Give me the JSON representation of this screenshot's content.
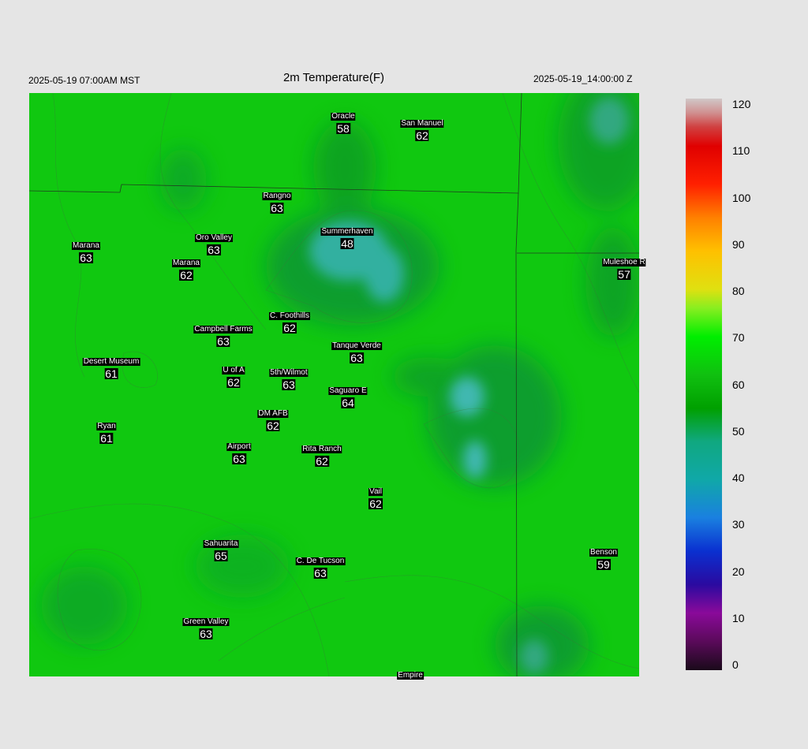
{
  "header": {
    "left": "2025-05-19 07:00AM MST",
    "title": "2m Temperature(F)",
    "right": "2025-05-19_14:00:00 Z"
  },
  "colorbar": {
    "min": 0,
    "max": 120,
    "ticks": [
      "120",
      "110",
      "100",
      "90",
      "80",
      "70",
      "60",
      "50",
      "40",
      "30",
      "20",
      "10",
      "0"
    ],
    "stops": [
      {
        "v": 0,
        "c": "#1a0a1a"
      },
      {
        "v": 6,
        "c": "#5a0a5a"
      },
      {
        "v": 12,
        "c": "#8a0a9a"
      },
      {
        "v": 18,
        "c": "#2a0aa0"
      },
      {
        "v": 25,
        "c": "#0a30d0"
      },
      {
        "v": 32,
        "c": "#1a80e0"
      },
      {
        "v": 40,
        "c": "#10a8a8"
      },
      {
        "v": 48,
        "c": "#10a880"
      },
      {
        "v": 55,
        "c": "#00a000"
      },
      {
        "v": 62,
        "c": "#10c010"
      },
      {
        "v": 70,
        "c": "#00ee00"
      },
      {
        "v": 76,
        "c": "#88ee20"
      },
      {
        "v": 80,
        "c": "#e0e010"
      },
      {
        "v": 88,
        "c": "#ffc000"
      },
      {
        "v": 95,
        "c": "#ff8000"
      },
      {
        "v": 102,
        "c": "#ff2000"
      },
      {
        "v": 110,
        "c": "#e00000"
      },
      {
        "v": 114,
        "c": "#d04040"
      },
      {
        "v": 117,
        "c": "#d09090"
      },
      {
        "v": 120,
        "c": "#d0c8c8"
      }
    ]
  },
  "stations": [
    {
      "name": "Oracle",
      "value": "58"
    },
    {
      "name": "San Manuel",
      "value": "62"
    },
    {
      "name": "Rangno",
      "value": "63"
    },
    {
      "name": "Summerhaven",
      "value": "48"
    },
    {
      "name": "Oro Valley",
      "value": "63"
    },
    {
      "name": "Marana",
      "value": "63"
    },
    {
      "name": "Marana",
      "value": "62"
    },
    {
      "name": "Muleshoe R",
      "value": "57"
    },
    {
      "name": "C. Foothills",
      "value": "62"
    },
    {
      "name": "Campbell Farms",
      "value": "63"
    },
    {
      "name": "Tanque Verde",
      "value": "63"
    },
    {
      "name": "Desert Museum",
      "value": "61"
    },
    {
      "name": "U of A",
      "value": "62"
    },
    {
      "name": "5th/Wilmot",
      "value": "63"
    },
    {
      "name": "Saguaro E",
      "value": "64"
    },
    {
      "name": "DM AFB",
      "value": "62"
    },
    {
      "name": "Ryan",
      "value": "61"
    },
    {
      "name": "Airport",
      "value": "63"
    },
    {
      "name": "Rita Ranch",
      "value": "62"
    },
    {
      "name": "Vail",
      "value": "62"
    },
    {
      "name": "Sahuarita",
      "value": "65"
    },
    {
      "name": "C. De Tucson",
      "value": "63"
    },
    {
      "name": "Benson",
      "value": "59"
    },
    {
      "name": "Green Valley",
      "value": "63"
    },
    {
      "name": "Empire",
      "value": ""
    }
  ]
}
